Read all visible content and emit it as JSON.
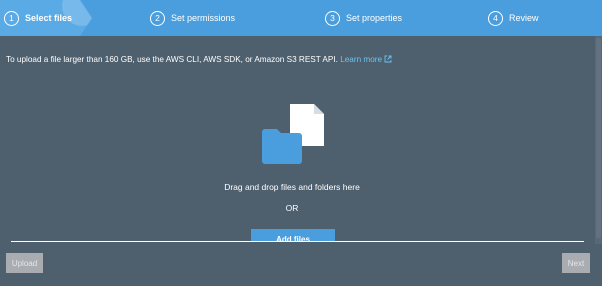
{
  "stepper": {
    "steps": [
      {
        "number": "1",
        "label": "Select files",
        "active": true
      },
      {
        "number": "2",
        "label": "Set permissions",
        "active": false
      },
      {
        "number": "3",
        "label": "Set properties",
        "active": false
      },
      {
        "number": "4",
        "label": "Review",
        "active": false
      }
    ]
  },
  "info": {
    "text": "To upload a file larger than 160 GB, use the AWS CLI, AWS SDK, or Amazon S3 REST API.",
    "link_label": "Learn more",
    "link_icon": "external-link-icon"
  },
  "dropzone": {
    "icon": "folder-and-file-icon",
    "text": "Drag and drop files and folders here",
    "or_text": "OR",
    "add_files_label": "Add files"
  },
  "footer": {
    "upload_label": "Upload",
    "next_label": "Next"
  },
  "colors": {
    "background": "#4e5f6d",
    "stepper": "#4a9ede",
    "link": "#6cc4f5",
    "disabled_button": "#a9adb1"
  }
}
